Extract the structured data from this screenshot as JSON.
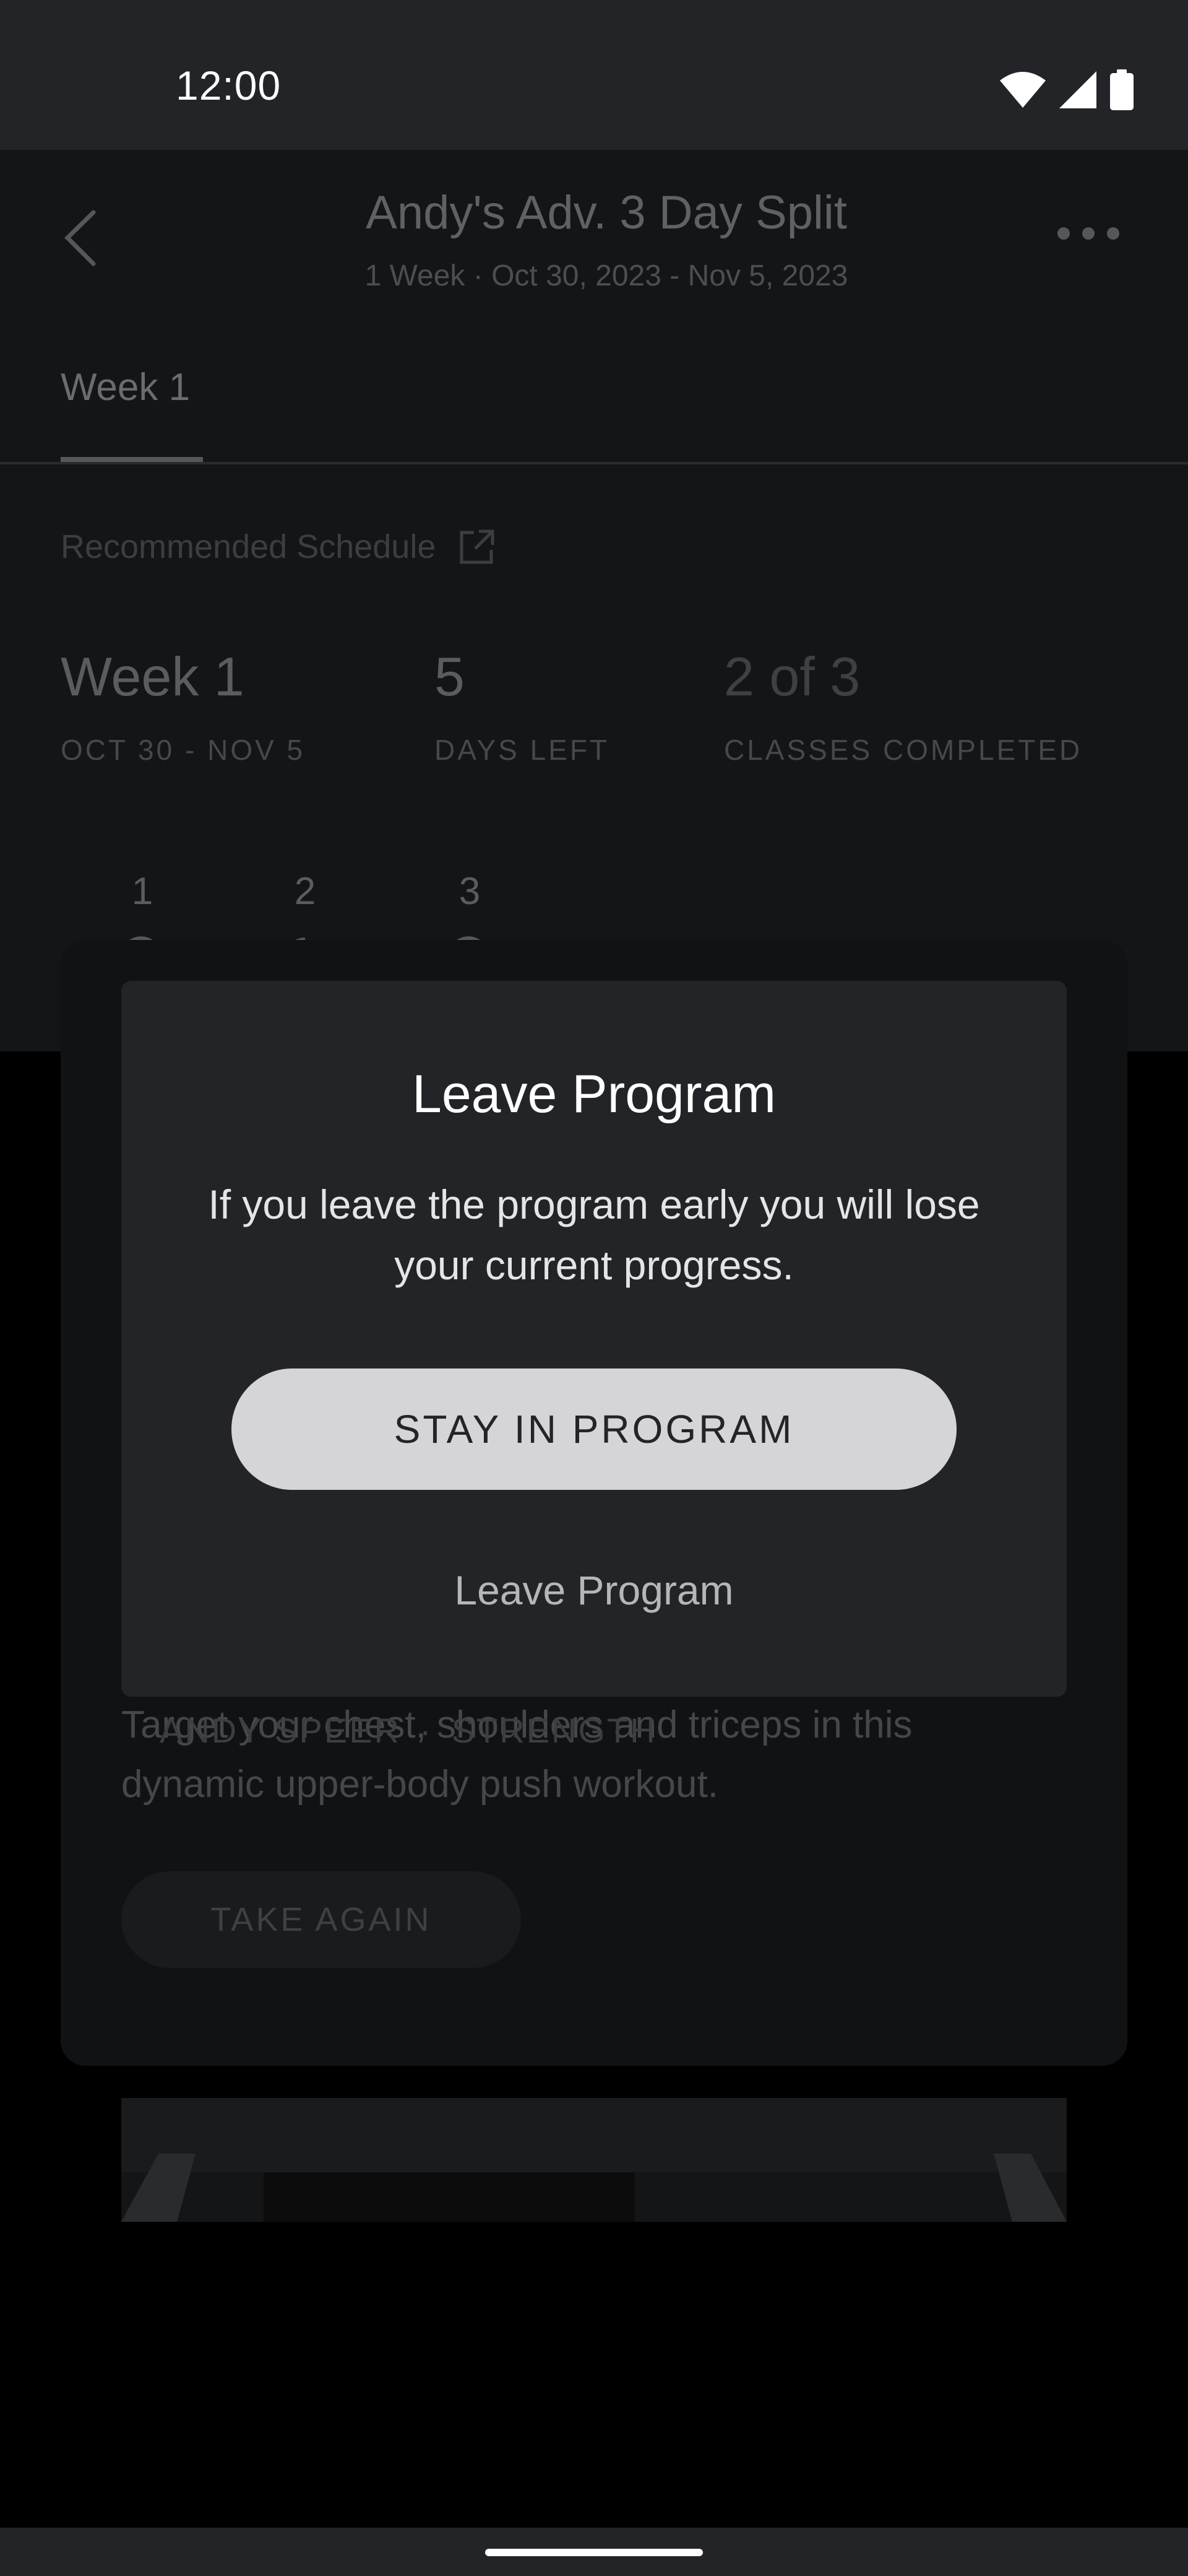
{
  "status_bar": {
    "time": "12:00",
    "icons": [
      "wifi-icon",
      "signal-icon",
      "battery-icon"
    ]
  },
  "header": {
    "title": "Andy's Adv. 3 Day Split",
    "subtitle": "1 Week · Oct 30, 2023 - Nov 5, 2023"
  },
  "tabs": [
    {
      "label": "Week 1",
      "active": true
    }
  ],
  "schedule": {
    "label": "Recommended Schedule",
    "stats": [
      {
        "value": "Week 1",
        "label": "OCT 30 - NOV 5"
      },
      {
        "value": "5",
        "label": "DAYS LEFT"
      },
      {
        "value": "2 of 3",
        "label": "CLASSES COMPLETED"
      }
    ],
    "days": [
      {
        "number": "1",
        "status": "completed"
      },
      {
        "number": "2",
        "status": "in-progress"
      },
      {
        "number": "3",
        "status": "completed"
      }
    ]
  },
  "class_card": {
    "instructor": "ANDY SPEER",
    "separator": "·",
    "category": "STRENGTH",
    "description": "Target your chest, shoulders and triceps in this dynamic upper-body push workout.",
    "action_label": "TAKE AGAIN"
  },
  "modal": {
    "title": "Leave Program",
    "body": "If you leave the program early you will lose your current progress.",
    "primary_label": "STAY IN PROGRAM",
    "secondary_label": "Leave Program"
  },
  "colors": {
    "modal_bg": "#222427",
    "primary_button_bg": "#d5d5d7",
    "scrim": "#000000"
  }
}
